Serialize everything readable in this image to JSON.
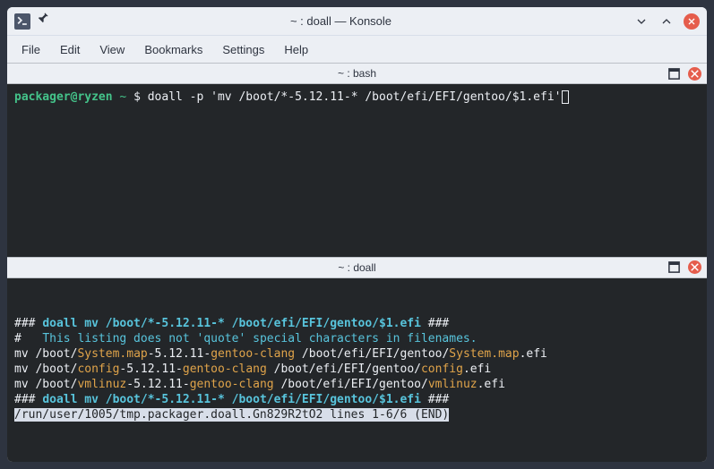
{
  "window": {
    "title": "~ : doall — Konsole"
  },
  "menu": {
    "file": "File",
    "edit": "Edit",
    "view": "View",
    "bookmarks": "Bookmarks",
    "settings": "Settings",
    "help": "Help"
  },
  "splits": {
    "top_title": "~ : bash",
    "bottom_title": "~ : doall"
  },
  "top": {
    "prompt_user": "packager@ryzen",
    "prompt_path": " ~ ",
    "prompt_symbol": "$ ",
    "command": "doall -p 'mv /boot/*-5.12.11-* /boot/efi/EFI/gentoo/$1.efi'"
  },
  "bottom": {
    "header_prefix": "### ",
    "header_cmd": "doall mv /boot/*-5.12.11-* /boot/efi/EFI/gentoo/$1.efi",
    "header_suffix": " ###",
    "comment_prefix": "#   ",
    "comment_text": "This listing does not 'quote' special characters in filenames.",
    "l1a": "mv /boot/",
    "l1b": "System.map",
    "l1c": "-5.12.11-",
    "l1d": "gentoo-clang",
    "l1e": " /boot/efi/EFI/gentoo/",
    "l1f": "System.map",
    "l1g": ".efi",
    "l2a": "mv /boot/",
    "l2b": "config",
    "l2c": "-5.12.11-",
    "l2d": "gentoo-clang",
    "l2e": " /boot/efi/EFI/gentoo/",
    "l2f": "config",
    "l2g": ".efi",
    "l3a": "mv /boot/",
    "l3b": "vmlinuz",
    "l3c": "-5.12.11-",
    "l3d": "gentoo-clang",
    "l3e": " /boot/efi/EFI/gentoo/",
    "l3f": "vmlinuz",
    "l3g": ".efi",
    "footer_prefix": "### ",
    "footer_cmd": "doall mv /boot/*-5.12.11-* /boot/efi/EFI/gentoo/$1.efi",
    "footer_suffix": " ###",
    "pager_status": "/run/user/1005/tmp.packager.doall.Gn829R2tO2 lines 1-6/6 (END)"
  }
}
